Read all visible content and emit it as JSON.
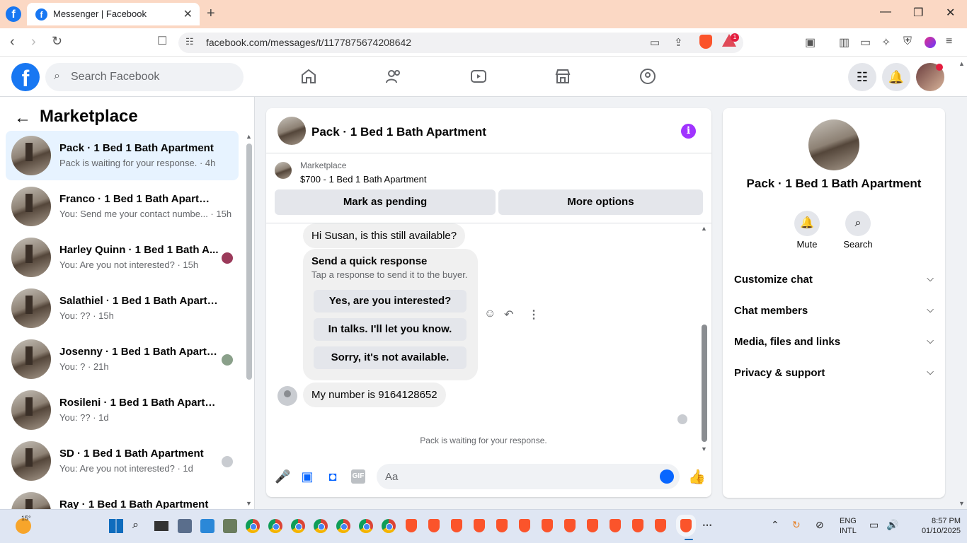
{
  "browser": {
    "tab_title": "Messenger | Facebook",
    "url": "facebook.com/messages/t/1177875674208642",
    "extension_badge": "1"
  },
  "fb_header": {
    "search_placeholder": "Search Facebook"
  },
  "left_panel": {
    "title": "Marketplace",
    "conversations": [
      {
        "name": "Pack · 1 Bed 1 Bath Apartment",
        "snippet": "Pack is waiting for your response. · 4h",
        "active": true
      },
      {
        "name": "Franco · 1 Bed 1 Bath Apartment",
        "snippet": "You: Send me your contact numbe... · 15h"
      },
      {
        "name": "Harley Quinn · 1 Bed 1 Bath A...",
        "snippet": "You: Are you not interested? · 15h"
      },
      {
        "name": "Salathiel · 1 Bed 1 Bath Apartment",
        "snippet": "You: ?? · 15h"
      },
      {
        "name": "Josenny · 1 Bed 1 Bath Apartm...",
        "snippet": "You: ? · 21h"
      },
      {
        "name": "Rosileni · 1 Bed 1 Bath Apartment",
        "snippet": "You: ?? · 1d"
      },
      {
        "name": "SD · 1 Bed 1 Bath Apartment",
        "snippet": "You: Are you not interested? · 1d"
      },
      {
        "name": "Ray · 1 Bed 1 Bath Apartment",
        "snippet": ""
      }
    ]
  },
  "chat": {
    "title": "Pack · 1 Bed 1 Bath Apartment",
    "marketplace_label": "Marketplace",
    "listing": "$700 - 1 Bed 1 Bath Apartment",
    "mark_pending": "Mark as pending",
    "more_options": "More options",
    "messages": [
      {
        "text": "Hi Susan, is this still available?"
      },
      {
        "text": "My number is 9164128652"
      }
    ],
    "quick_response": {
      "title": "Send a quick response",
      "subtitle": "Tap a response to send it to the buyer.",
      "options": [
        "Yes, are you interested?",
        "In talks. I'll let you know.",
        "Sorry, it's not available."
      ]
    },
    "waiting_text": "Pack is waiting for your response.",
    "composer_placeholder": "Aa"
  },
  "right_panel": {
    "name": "Pack · 1 Bed 1 Bath Apartment",
    "mute_label": "Mute",
    "search_label": "Search",
    "sections": [
      "Customize chat",
      "Chat members",
      "Media, files and links",
      "Privacy & support"
    ]
  },
  "taskbar": {
    "temperature": "15°",
    "lang_1": "ENG",
    "lang_2": "INTL",
    "time": "8:57 PM",
    "date": "01/10/2025"
  },
  "colors": {
    "fb_blue": "#1877f2",
    "messenger_blue": "#0866ff",
    "info_purple": "#a033ff",
    "active_row": "#e7f3ff"
  }
}
